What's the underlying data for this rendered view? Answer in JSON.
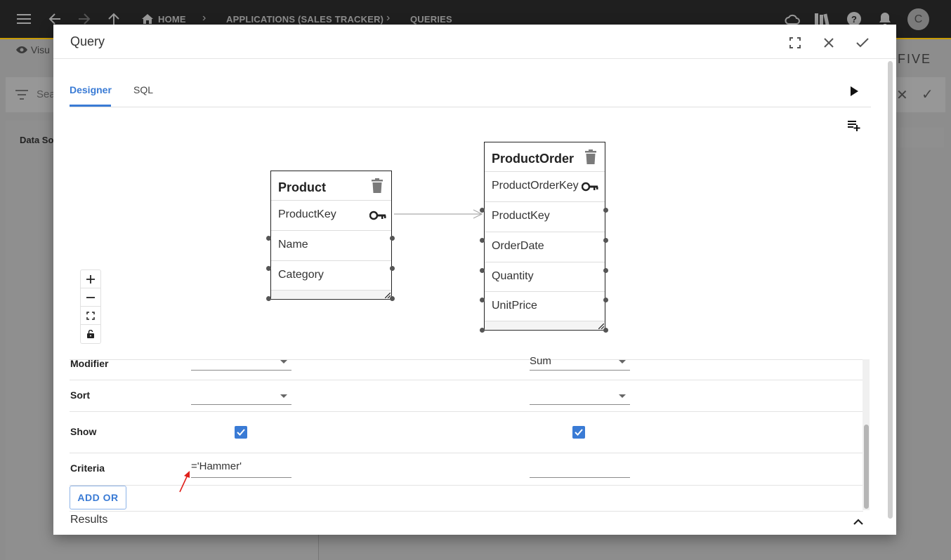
{
  "appbar": {
    "home": "HOME",
    "crumb_app": "APPLICATIONS (SALES TRACKER)",
    "crumb_page": "QUERIES",
    "avatar_letter": "C"
  },
  "background": {
    "visual_label": "Visu",
    "search_placeholder": "Sea",
    "tab_label": "Data So",
    "brand": "FIVE"
  },
  "dialog": {
    "title": "Query",
    "tabs": [
      {
        "label": "Designer",
        "active": true
      },
      {
        "label": "SQL",
        "active": false
      }
    ]
  },
  "designer": {
    "tables": [
      {
        "name": "Product",
        "fields": [
          "ProductKey",
          "Name",
          "Category"
        ],
        "key_field": "ProductKey"
      },
      {
        "name": "ProductOrder",
        "fields": [
          "ProductOrderKey",
          "ProductKey",
          "OrderDate",
          "Quantity",
          "UnitPrice"
        ],
        "key_field": "ProductOrderKey"
      }
    ],
    "zoom_controls": [
      "zoom-in",
      "zoom-out",
      "fit",
      "lock"
    ]
  },
  "grid": {
    "rows": {
      "modifier": {
        "label": "Modifier",
        "col1": "",
        "col2": "Sum"
      },
      "sort": {
        "label": "Sort",
        "col1": "",
        "col2": ""
      },
      "show": {
        "label": "Show",
        "col1": true,
        "col2": true
      },
      "criteria": {
        "label": "Criteria",
        "col1": "='Hammer'",
        "col2": ""
      }
    },
    "add_or_label": "ADD OR"
  },
  "results_label": "Results",
  "colors": {
    "accent": "#3a7bd5",
    "annotation_arrow": "#e0201b"
  }
}
